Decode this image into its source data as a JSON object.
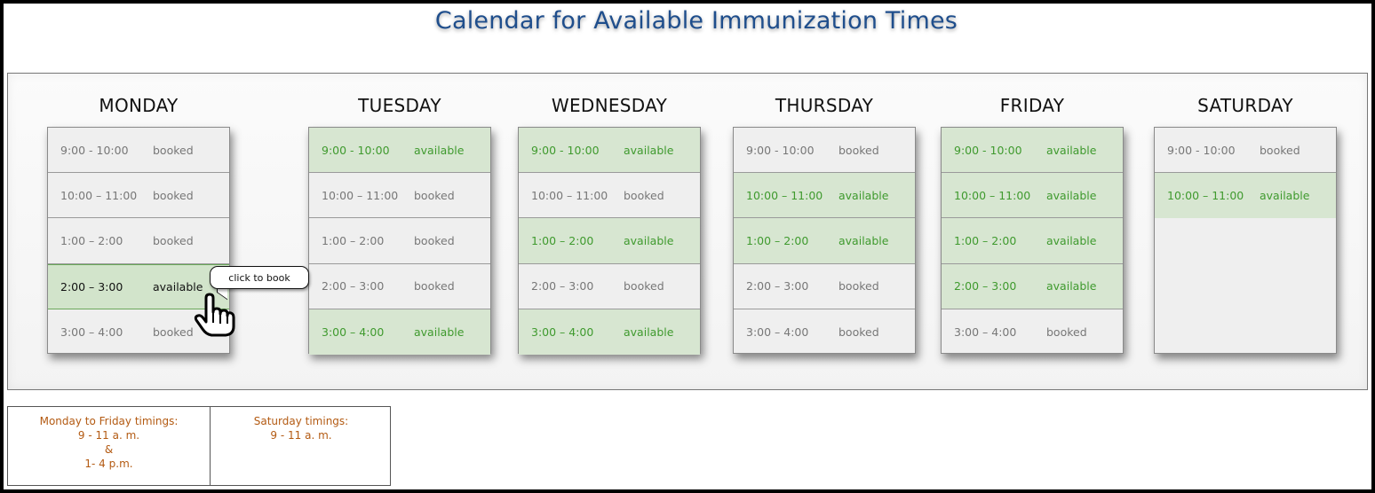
{
  "title": "Calendar for Available Immunization Times",
  "days": [
    {
      "name": "MONDAY",
      "slots": [
        {
          "time": "9:00 - 10:00",
          "status": "booked"
        },
        {
          "time": "10:00 – 11:00",
          "status": "booked"
        },
        {
          "time": "1:00 – 2:00",
          "status": "booked"
        },
        {
          "time": "2:00 – 3:00",
          "status": "available"
        },
        {
          "time": "3:00 – 4:00",
          "status": "booked"
        }
      ]
    },
    {
      "name": "TUESDAY",
      "slots": [
        {
          "time": "9:00 - 10:00",
          "status": "available"
        },
        {
          "time": "10:00 – 11:00",
          "status": "booked"
        },
        {
          "time": "1:00 – 2:00",
          "status": "booked"
        },
        {
          "time": "2:00 – 3:00",
          "status": "booked"
        },
        {
          "time": "3:00 – 4:00",
          "status": "available"
        }
      ]
    },
    {
      "name": "WEDNESDAY",
      "slots": [
        {
          "time": "9:00 - 10:00",
          "status": "available"
        },
        {
          "time": "10:00 – 11:00",
          "status": "booked"
        },
        {
          "time": "1:00 – 2:00",
          "status": "available"
        },
        {
          "time": "2:00 – 3:00",
          "status": "booked"
        },
        {
          "time": "3:00 – 4:00",
          "status": "available"
        }
      ]
    },
    {
      "name": "THURSDAY",
      "slots": [
        {
          "time": "9:00 - 10:00",
          "status": "booked"
        },
        {
          "time": "10:00 – 11:00",
          "status": "available"
        },
        {
          "time": "1:00 – 2:00",
          "status": "available"
        },
        {
          "time": "2:00 – 3:00",
          "status": "booked"
        },
        {
          "time": "3:00 – 4:00",
          "status": "booked"
        }
      ]
    },
    {
      "name": "FRIDAY",
      "slots": [
        {
          "time": "9:00 - 10:00",
          "status": "available"
        },
        {
          "time": "10:00 – 11:00",
          "status": "available"
        },
        {
          "time": "1:00 – 2:00",
          "status": "available"
        },
        {
          "time": "2:00 – 3:00",
          "status": "available"
        },
        {
          "time": "3:00 – 4:00",
          "status": "booked"
        }
      ]
    },
    {
      "name": "SATURDAY",
      "slots": [
        {
          "time": "9:00 - 10:00",
          "status": "booked"
        },
        {
          "time": "10:00 – 11:00",
          "status": "available"
        }
      ]
    }
  ],
  "tooltip": "click to book",
  "notes": {
    "weekday_title": "Monday to Friday timings:",
    "weekday_line1": "9 - 11 a. m.",
    "weekday_line2": "&",
    "weekday_line3": "1- 4 p.m.",
    "saturday_title": "Saturday timings:",
    "saturday_line1": "9 - 11 a. m."
  },
  "colors": {
    "title": "#1f4e8c",
    "available_bg": "#d7e6d1",
    "available_text": "#3f9a2e",
    "booked_text": "#777777",
    "notes_text": "#b35a12"
  },
  "icons": {
    "cursor": "hand-pointer-icon"
  }
}
